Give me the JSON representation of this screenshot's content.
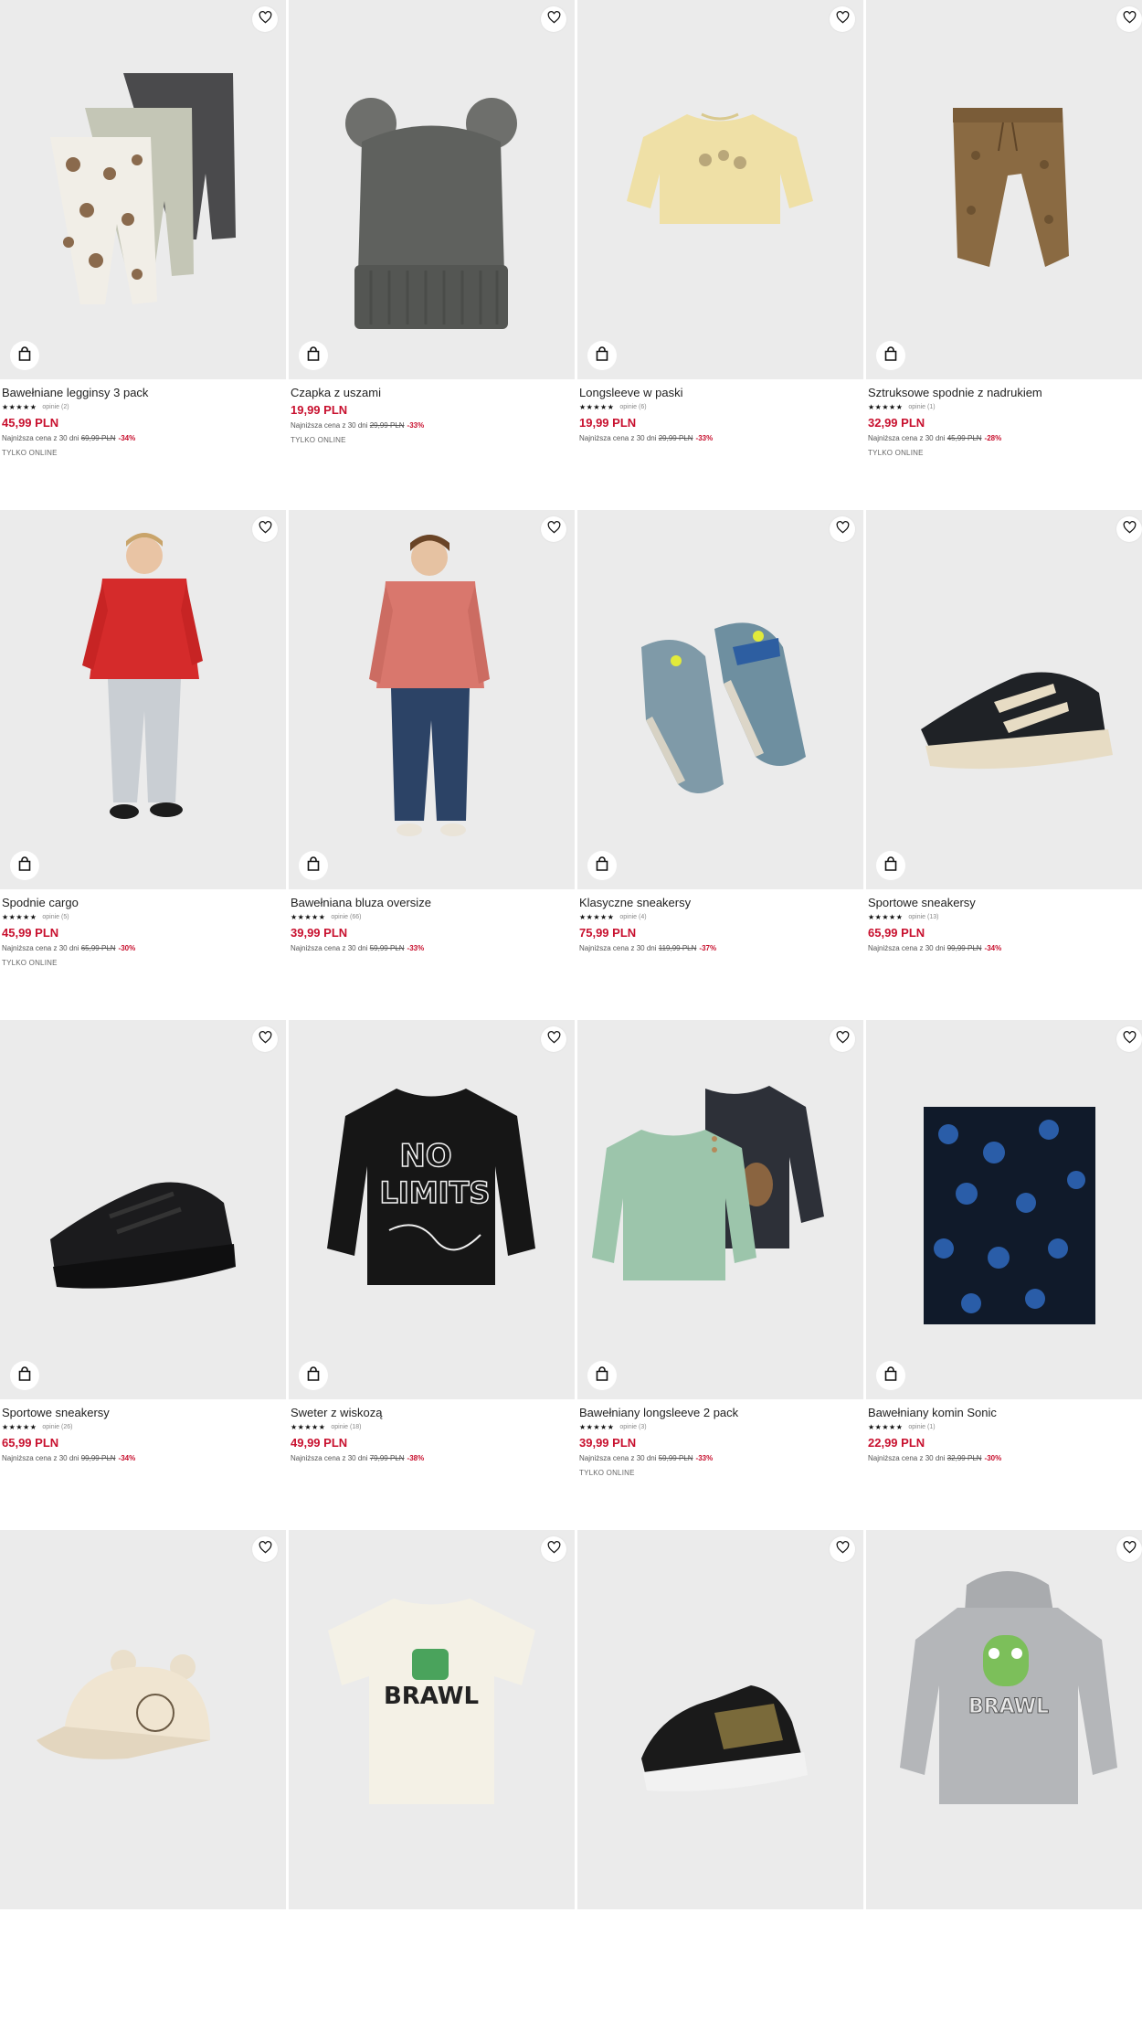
{
  "products": [
    {
      "name": "Bawełniane legginsy 3 pack",
      "stars": "★★★★★",
      "opinions": "opinie (2)",
      "price": "45,99 PLN",
      "lowest_label": "Najniższa cena z 30 dni",
      "old_price": "69,99 PLN",
      "discount": "-34%",
      "badge": "TYLKO ONLINE",
      "image": "leggings-3pack",
      "has_rating": true
    },
    {
      "name": "Czapka z uszami",
      "stars": "",
      "opinions": "",
      "price": "19,99 PLN",
      "lowest_label": "Najniższa cena z 30 dni",
      "old_price": "29,99 PLN",
      "discount": "-33%",
      "badge": "TYLKO ONLINE",
      "image": "knit-beanie-pompoms",
      "has_rating": false
    },
    {
      "name": "Longsleeve w paski",
      "stars": "★★★★★",
      "opinions": "opinie (6)",
      "price": "19,99 PLN",
      "lowest_label": "Najniższa cena z 30 dni",
      "old_price": "29,99 PLN",
      "discount": "-33%",
      "badge": "",
      "image": "yellow-longsleeve",
      "has_rating": true
    },
    {
      "name": "Sztruksowe spodnie z nadrukiem",
      "stars": "★★★★★",
      "opinions": "opinie (1)",
      "price": "32,99 PLN",
      "lowest_label": "Najniższa cena z 30 dni",
      "old_price": "45,99 PLN",
      "discount": "-28%",
      "badge": "TYLKO ONLINE",
      "image": "brown-joggers",
      "has_rating": true
    },
    {
      "name": "Spodnie cargo",
      "stars": "★★★★★",
      "opinions": "opinie (5)",
      "price": "45,99 PLN",
      "lowest_label": "Najniższa cena z 30 dni",
      "old_price": "65,99 PLN",
      "discount": "-30%",
      "badge": "TYLKO ONLINE",
      "image": "boy-red-hoodie",
      "has_rating": true
    },
    {
      "name": "Bawełniana bluza oversize",
      "stars": "★★★★★",
      "opinions": "opinie (66)",
      "price": "39,99 PLN",
      "lowest_label": "Najniższa cena z 30 dni",
      "old_price": "59,99 PLN",
      "discount": "-33%",
      "badge": "",
      "image": "boy-pink-hoodie",
      "has_rating": true
    },
    {
      "name": "Klasyczne sneakersy",
      "stars": "★★★★★",
      "opinions": "opinie (4)",
      "price": "75,99 PLN",
      "lowest_label": "Najniższa cena z 30 dni",
      "old_price": "119,99 PLN",
      "discount": "-37%",
      "badge": "",
      "image": "blue-sneakers",
      "has_rating": true
    },
    {
      "name": "Sportowe sneakersy",
      "stars": "★★★★★",
      "opinions": "opinie (13)",
      "price": "65,99 PLN",
      "lowest_label": "Najniższa cena z 30 dni",
      "old_price": "99,99 PLN",
      "discount": "-34%",
      "badge": "",
      "image": "black-beige-sneaker",
      "has_rating": true
    },
    {
      "name": "Sportowe sneakersy",
      "stars": "★★★★★",
      "opinions": "opinie (26)",
      "price": "65,99 PLN",
      "lowest_label": "Najniższa cena z 30 dni",
      "old_price": "99,99 PLN",
      "discount": "-34%",
      "badge": "",
      "image": "black-sneaker",
      "has_rating": true
    },
    {
      "name": "Sweter z wiskozą",
      "stars": "★★★★★",
      "opinions": "opinie (18)",
      "price": "49,99 PLN",
      "lowest_label": "Najniższa cena z 30 dni",
      "old_price": "79,99 PLN",
      "discount": "-38%",
      "badge": "",
      "image": "black-sweater",
      "has_rating": true
    },
    {
      "name": "Bawełniany longsleeve 2 pack",
      "stars": "★★★★★",
      "opinions": "opinie (3)",
      "price": "39,99 PLN",
      "lowest_label": "Najniższa cena z 30 dni",
      "old_price": "59,99 PLN",
      "discount": "-33%",
      "badge": "TYLKO ONLINE",
      "image": "longsleeve-2pack",
      "has_rating": true
    },
    {
      "name": "Bawełniany komin Sonic",
      "stars": "★★★★★",
      "opinions": "opinie (1)",
      "price": "22,99 PLN",
      "lowest_label": "Najniższa cena z 30 dni",
      "old_price": "32,99 PLN",
      "discount": "-30%",
      "badge": "",
      "image": "sonic-snood",
      "has_rating": true
    },
    {
      "name": "",
      "stars": "",
      "opinions": "",
      "price": "",
      "lowest_label": "",
      "old_price": "",
      "discount": "",
      "badge": "",
      "image": "beige-cap",
      "has_rating": false
    },
    {
      "name": "",
      "stars": "",
      "opinions": "",
      "price": "",
      "lowest_label": "",
      "old_price": "",
      "discount": "",
      "badge": "",
      "image": "brawl-tshirt",
      "has_rating": false
    },
    {
      "name": "",
      "stars": "",
      "opinions": "",
      "price": "",
      "lowest_label": "",
      "old_price": "",
      "discount": "",
      "badge": "",
      "image": "high-top-sneaker",
      "has_rating": false
    },
    {
      "name": "",
      "stars": "",
      "opinions": "",
      "price": "",
      "lowest_label": "",
      "old_price": "",
      "discount": "",
      "badge": "",
      "image": "brawl-hoodie",
      "has_rating": false
    }
  ],
  "image_text": {
    "sweater_line1": "NO",
    "sweater_line2": "LIMITS",
    "brawl": "BRAWL"
  },
  "colors": {
    "price_red": "#c8102e",
    "image_bg": "#ebebeb"
  }
}
